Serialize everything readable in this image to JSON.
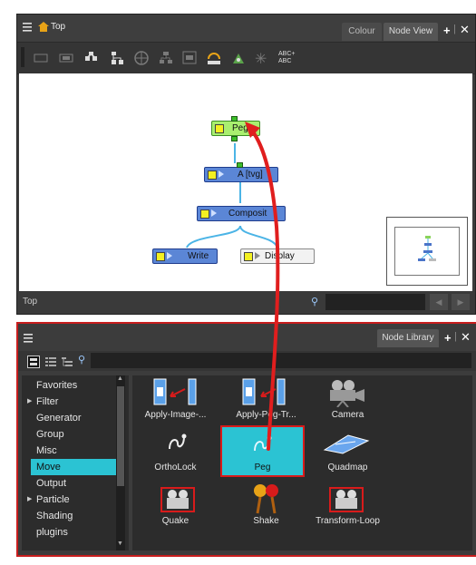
{
  "top_panel": {
    "breadcrumb": "Top",
    "tabs": [
      "Colour",
      "Node View"
    ],
    "status_text": "Top"
  },
  "nodes": {
    "peg": "Peg",
    "a": "A [tvg]",
    "composite": "Composit",
    "write": "Write",
    "display": "Display"
  },
  "toolbar_text_icon": "ABC+ ABC",
  "library": {
    "tab_label": "Node Library",
    "categories": [
      "Favorites",
      "Filter",
      "Generator",
      "Group",
      "Misc",
      "Move",
      "Output",
      "Particle",
      "Shading",
      "plugins"
    ],
    "selected_category": "Move",
    "tiles": [
      "Apply-Image-...",
      "Apply-Peg-Tr...",
      "Camera",
      "OrthoLock",
      "Peg",
      "Quadmap",
      "Quake",
      "Shake",
      "Transform-Loop"
    ],
    "selected_tile": "Peg"
  },
  "colors": {
    "accent": "#2bc3d3",
    "highlight": "#d81b1b",
    "panel": "#3c3c3c"
  }
}
